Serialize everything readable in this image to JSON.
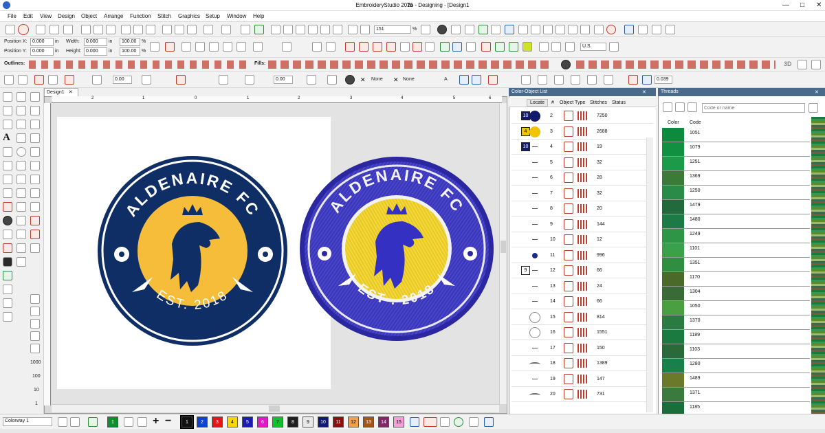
{
  "window": {
    "title": "EmbroideryStudio 2026 - Designing - [Design1",
    "title_suffix": "Ta",
    "controls": [
      "—",
      "□",
      "✕"
    ]
  },
  "menu": [
    "File",
    "Edit",
    "View",
    "Design",
    "Object",
    "Arrange",
    "Function",
    "Stitch",
    "Graphics",
    "Setup",
    "Window",
    "Help"
  ],
  "toolbar": {
    "stitch_count_field": "151",
    "position_x_label": "Position X:",
    "position_x_value": "0.000",
    "position_y_label": "Position Y:",
    "position_y_value": "0.000",
    "width_label": "Width:",
    "width_value": "0.000",
    "height_label": "Height:",
    "height_value": "0.000",
    "pct_w": "100.00",
    "pct_h": "100.00",
    "unit": "%",
    "in_unit": "in",
    "angle": "0.00",
    "region": "U.S.",
    "outlines_label": "Outlines:",
    "fills_label": "Fills:",
    "none1": "None",
    "none2": "None",
    "a_label": "A",
    "val_0039": "0.039",
    "val_000a": "0.00",
    "val_000b": "0.00",
    "threed": "3D"
  },
  "document": {
    "tab_label": "Design1",
    "ruler_marks": [
      "2",
      "1",
      "0",
      "1",
      "2",
      "3",
      "4",
      "5",
      "6"
    ]
  },
  "logo": {
    "top_text": "ALDENAIRE FC",
    "bottom_text": "EST. 2018",
    "embroidered_top_text": "ALDENAIRE FC",
    "embroidered_bottom_text": "EST . 2018",
    "colors": {
      "navy": "#102e66",
      "gold": "#f6bd3a",
      "royal": "#3b37b8",
      "yellow": "#e9c925",
      "white": "#ffffff"
    }
  },
  "color_object_list": {
    "title": "Color-Object List",
    "columns": [
      "Locate",
      "#",
      "Object Type",
      "Stitches",
      "Status"
    ],
    "rows": [
      {
        "group": "10",
        "num": "2",
        "stitches": "7250",
        "color": "#13196b",
        "preview": "circle-navy"
      },
      {
        "group": "4",
        "num": "3",
        "stitches": "2688",
        "color": "#f2c400",
        "preview": "circle-gold"
      },
      {
        "group": "10",
        "num": "4",
        "stitches": "19",
        "color": "#13196b",
        "preview": "dash"
      },
      {
        "group": "",
        "num": "5",
        "stitches": "32",
        "color": "",
        "preview": "dash"
      },
      {
        "group": "",
        "num": "6",
        "stitches": "28",
        "color": "",
        "preview": "dash"
      },
      {
        "group": "",
        "num": "7",
        "stitches": "32",
        "color": "",
        "preview": "dash"
      },
      {
        "group": "",
        "num": "8",
        "stitches": "20",
        "color": "",
        "preview": "dash"
      },
      {
        "group": "",
        "num": "9",
        "stitches": "144",
        "color": "",
        "preview": "dash"
      },
      {
        "group": "",
        "num": "10",
        "stitches": "12",
        "color": "",
        "preview": "dash"
      },
      {
        "group": "",
        "num": "11",
        "stitches": "996",
        "color": "",
        "preview": "blob"
      },
      {
        "group": "9",
        "num": "12",
        "stitches": "66",
        "color": "#ffffff",
        "preview": "dash"
      },
      {
        "group": "",
        "num": "13",
        "stitches": "24",
        "color": "",
        "preview": "dash"
      },
      {
        "group": "",
        "num": "14",
        "stitches": "66",
        "color": "",
        "preview": "dash"
      },
      {
        "group": "",
        "num": "15",
        "stitches": "814",
        "color": "",
        "preview": "ring"
      },
      {
        "group": "",
        "num": "16",
        "stitches": "1551",
        "color": "",
        "preview": "ring"
      },
      {
        "group": "",
        "num": "17",
        "stitches": "150",
        "color": "",
        "preview": "dash"
      },
      {
        "group": "",
        "num": "18",
        "stitches": "1389",
        "color": "",
        "preview": "arc"
      },
      {
        "group": "",
        "num": "19",
        "stitches": "147",
        "color": "",
        "preview": "dash"
      },
      {
        "group": "",
        "num": "20",
        "stitches": "731",
        "color": "",
        "preview": "arc"
      }
    ]
  },
  "threads": {
    "title": "Threads",
    "search_placeholder": "Code or name",
    "columns": [
      "Color",
      "Code"
    ],
    "rows": [
      {
        "code": "1051",
        "color": "#0e8a3e"
      },
      {
        "code": "1079",
        "color": "#109040"
      },
      {
        "code": "1251",
        "color": "#1b9a4a"
      },
      {
        "code": "1369",
        "color": "#3c7a3a"
      },
      {
        "code": "1250",
        "color": "#2a8a48"
      },
      {
        "code": "1479",
        "color": "#226a3e"
      },
      {
        "code": "1480",
        "color": "#1c7a44"
      },
      {
        "code": "1249",
        "color": "#2c9646"
      },
      {
        "code": "1101",
        "color": "#3aa04a"
      },
      {
        "code": "1351",
        "color": "#2f8e40"
      },
      {
        "code": "1170",
        "color": "#4a6a2a"
      },
      {
        "code": "1304",
        "color": "#3a6a38"
      },
      {
        "code": "1050",
        "color": "#4aa040"
      },
      {
        "code": "1370",
        "color": "#2b7a44"
      },
      {
        "code": "1189",
        "color": "#1a7a40"
      },
      {
        "code": "1103",
        "color": "#2a6a3a"
      },
      {
        "code": "1280",
        "color": "#18804a"
      },
      {
        "code": "1489",
        "color": "#6a7a2a"
      },
      {
        "code": "1371",
        "color": "#3a7a3e"
      },
      {
        "code": "1185",
        "color": "#1a6e3a"
      }
    ]
  },
  "bottom": {
    "colorway": "Colorway 1",
    "palette": [
      {
        "n": "1",
        "c": "#0d8f2d"
      },
      {
        "n": "1",
        "c": "#111111"
      },
      {
        "n": "2",
        "c": "#1040d0"
      },
      {
        "n": "3",
        "c": "#e01818"
      },
      {
        "n": "4",
        "c": "#f5d800"
      },
      {
        "n": "5",
        "c": "#1c1cb0"
      },
      {
        "n": "6",
        "c": "#e018c8"
      },
      {
        "n": "7",
        "c": "#10c030"
      },
      {
        "n": "8",
        "c": "#202020"
      },
      {
        "n": "9",
        "c": "#e8e8e8"
      },
      {
        "n": "10",
        "c": "#101870"
      },
      {
        "n": "11",
        "c": "#8a1010"
      },
      {
        "n": "12",
        "c": "#f0a050"
      },
      {
        "n": "13",
        "c": "#a05818"
      },
      {
        "n": "14",
        "c": "#80286a"
      },
      {
        "n": "15",
        "c": "#f6a0d8"
      }
    ]
  },
  "left_tools_values": [
    "1000",
    "100",
    "10",
    "1"
  ]
}
